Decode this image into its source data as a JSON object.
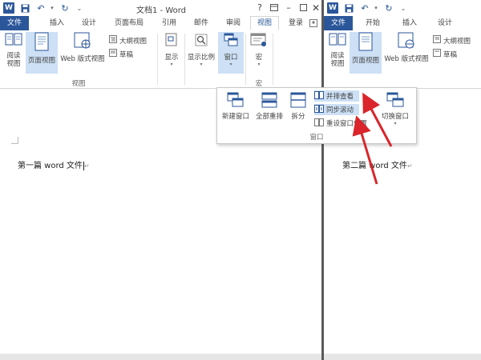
{
  "left_window": {
    "title": "文档1 - Word",
    "signin": "登录",
    "tabs": [
      "文件",
      "插入",
      "设计",
      "页面布局",
      "引用",
      "邮件",
      "审阅",
      "视图"
    ],
    "active_tab": "视图",
    "view_group": {
      "label": "视图",
      "read_mode": "阅读\n视图",
      "print_layout": "页面视图",
      "web_layout": "Web 版式视图",
      "outline": "大纲视图",
      "draft": "草稿"
    },
    "show": "显示",
    "zoom": "显示比例",
    "window": "窗口",
    "macros": "宏",
    "macros_group_label": "宏",
    "doc_text": "第一篇 word 文件",
    "paragraph_mark": "↵"
  },
  "right_window": {
    "tabs": [
      "文件",
      "开始",
      "插入",
      "设计"
    ],
    "view_group": {
      "read_mode": "阅读\n视图",
      "print_layout": "页面视图",
      "web_layout": "Web 版式视图",
      "outline": "大纲视图",
      "draft": "草稿"
    },
    "doc_text": "第二篇 word 文件",
    "paragraph_mark": "↵"
  },
  "window_dropdown": {
    "new_window": "新建窗口",
    "arrange_all": "全部重排",
    "split": "拆分",
    "view_side_by_side": "并排查看",
    "sync_scrolling": "同步滚动",
    "reset_window_position": "重设窗口位置",
    "switch_windows": "切换窗口",
    "group_label": "窗口"
  },
  "colors": {
    "accent": "#2b579a",
    "selected": "#cde0f5",
    "arrow": "#d9252b"
  }
}
